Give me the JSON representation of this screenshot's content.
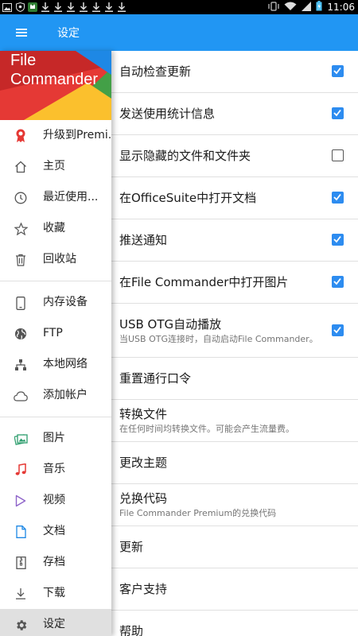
{
  "status_bar": {
    "time": "11:06",
    "notification_icons": [
      "image-icon",
      "shield-icon",
      "cat-icon",
      "download-icon",
      "download-icon",
      "download-icon",
      "download-icon",
      "download-icon",
      "download-icon",
      "download-icon"
    ],
    "right_icons": [
      "vibrate-icon",
      "wifi-icon",
      "signal-icon",
      "battery-icon"
    ]
  },
  "app_bar": {
    "title": "设定",
    "menu_icon": "hamburger-menu-icon",
    "color": "#2196f3"
  },
  "drawer": {
    "brand_line1": "File",
    "brand_line2": "Commander",
    "sections": [
      [
        {
          "label": "升级到Premi...",
          "icon": "premium-badge-icon"
        },
        {
          "label": "主页",
          "icon": "home-icon"
        },
        {
          "label": "最近使用...",
          "icon": "clock-icon"
        },
        {
          "label": "收藏",
          "icon": "star-icon"
        },
        {
          "label": "回收站",
          "icon": "trash-icon"
        }
      ],
      [
        {
          "label": "内存设备",
          "icon": "phone-icon"
        },
        {
          "label": "FTP",
          "icon": "globe-icon"
        },
        {
          "label": "本地网络",
          "icon": "network-icon"
        },
        {
          "label": "添加帐户",
          "icon": "cloud-icon"
        }
      ],
      [
        {
          "label": "图片",
          "icon": "pictures-icon"
        },
        {
          "label": "音乐",
          "icon": "music-icon"
        },
        {
          "label": "视频",
          "icon": "video-play-icon"
        },
        {
          "label": "文档",
          "icon": "document-icon"
        },
        {
          "label": "存档",
          "icon": "archive-icon"
        },
        {
          "label": "下载",
          "icon": "download-icon"
        },
        {
          "label": "设定",
          "icon": "gear-icon",
          "active": true
        }
      ]
    ]
  },
  "settings": [
    {
      "title": "自动检查更新",
      "checkbox": true,
      "checked": true
    },
    {
      "title": "发送使用统计信息",
      "checkbox": true,
      "checked": true
    },
    {
      "title": "显示隐藏的文件和文件夹",
      "checkbox": true,
      "checked": false
    },
    {
      "title": "在OfficeSuite中打开文档",
      "checkbox": true,
      "checked": true
    },
    {
      "title": "推送通知",
      "checkbox": true,
      "checked": true
    },
    {
      "title": "在File Commander中打开图片",
      "checkbox": true,
      "checked": true
    },
    {
      "title": "USB OTG自动播放",
      "subtitle": "当USB OTG连接时，自动启动File Commander。",
      "checkbox": true,
      "checked": true
    },
    {
      "title": "重置通行口令",
      "checkbox": false
    },
    {
      "title": "转换文件",
      "subtitle": "在任何时间均转换文件。可能会产生流量费。",
      "checkbox": false
    },
    {
      "title": "更改主题",
      "checkbox": false
    },
    {
      "title": "兑换代码",
      "subtitle": "File Commander Premium的兑换代码",
      "checkbox": false
    },
    {
      "title": "更新",
      "checkbox": false
    },
    {
      "title": "客户支持",
      "checkbox": false
    },
    {
      "title": "帮助",
      "checkbox": false
    }
  ]
}
